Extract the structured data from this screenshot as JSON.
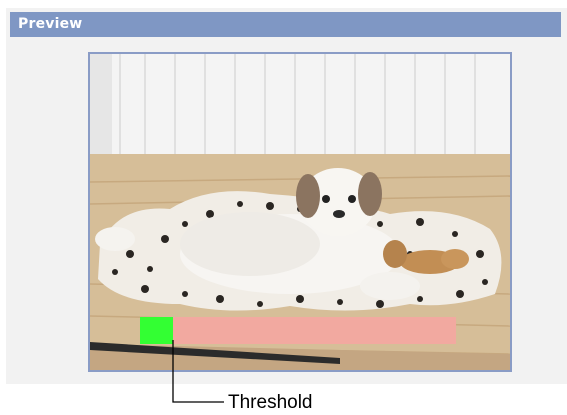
{
  "panel": {
    "title": "Preview"
  },
  "meter": {
    "level_color": "#33ff33",
    "rest_color": "#f2a9a0",
    "threshold_label": "Threshold"
  },
  "colors": {
    "header": "#7f97c4",
    "frame_border": "#8a9cc6",
    "panel_background": "#f2f2f2"
  }
}
